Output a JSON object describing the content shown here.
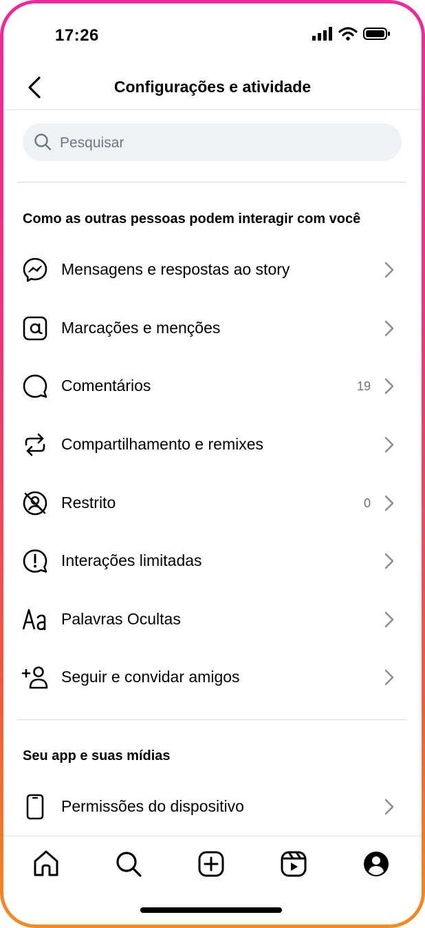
{
  "status": {
    "time": "17:26"
  },
  "header": {
    "title": "Configurações e atividade"
  },
  "search": {
    "placeholder": "Pesquisar"
  },
  "section1": {
    "title": "Como as outras pessoas podem interagir com você",
    "items": [
      {
        "label": "Mensagens e respostas ao story",
        "icon": "messenger-icon",
        "count": ""
      },
      {
        "label": "Marcações e menções",
        "icon": "at-sign-icon",
        "count": ""
      },
      {
        "label": "Comentários",
        "icon": "comment-icon",
        "count": "19"
      },
      {
        "label": "Compartilhamento e remixes",
        "icon": "repost-icon",
        "count": ""
      },
      {
        "label": "Restrito",
        "icon": "restricted-icon",
        "count": "0"
      },
      {
        "label": "Interações limitadas",
        "icon": "alert-bubble-icon",
        "count": ""
      },
      {
        "label": "Palavras Ocultas",
        "icon": "text-aa-icon",
        "count": ""
      },
      {
        "label": "Seguir e convidar amigos",
        "icon": "add-person-icon",
        "count": ""
      }
    ]
  },
  "section2": {
    "title": "Seu app e suas mídias",
    "items": [
      {
        "label": "Permissões do dispositivo",
        "icon": "phone-icon",
        "count": ""
      }
    ]
  },
  "tabbar": {
    "tabs": [
      "home-icon",
      "search-icon",
      "create-icon",
      "reels-icon",
      "profile-icon"
    ]
  }
}
